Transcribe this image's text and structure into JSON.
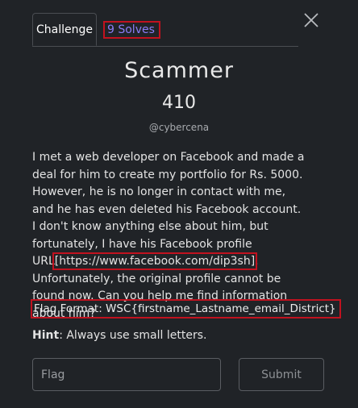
{
  "tabs": {
    "challenge_label": "Challenge",
    "solves_label": "9 Solves"
  },
  "challenge": {
    "title": "Scammer",
    "points": "410",
    "author": "@cybercena",
    "description_before": "I met a web developer on Facebook and made a deal for him to create my portfolio for Rs. 5000. However, he is no longer in contact with me, and he has even deleted his Facebook account. I don't know anything else about him, but fortunately, I have his Facebook profile URL",
    "description_url": "[https://www.facebook.com/dip3sh]",
    "description_after": ". Unfortunately, the original profile cannot be found now. Can you help me find information about him?",
    "flag_format": "Flag Format: WSC{firstname_Lastname_email_District}",
    "hint_label": "Hint",
    "hint_text": ": Always use small letters."
  },
  "form": {
    "flag_placeholder": "Flag",
    "flag_value": "",
    "submit_label": "Submit"
  },
  "colors": {
    "background": "#202327",
    "highlight_border": "#c1121f",
    "solves_link": "#8b7cf6"
  },
  "icons": {
    "close": "close-icon"
  }
}
